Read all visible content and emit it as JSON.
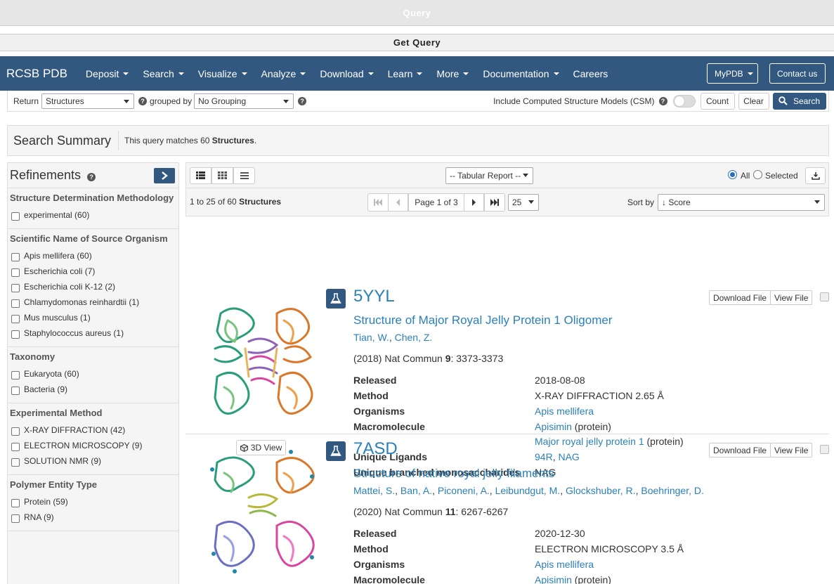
{
  "query_bar": {
    "title": "Query"
  },
  "get_query_bar": {
    "title": "Get Query"
  },
  "nav": {
    "brand": "RCSB PDB",
    "items": [
      "Deposit",
      "Search",
      "Visualize",
      "Analyze",
      "Download",
      "Learn",
      "More",
      "Documentation"
    ],
    "careers": "Careers",
    "mypdb": "MyPDB",
    "contact": "Contact us"
  },
  "search_row": {
    "return_label": "Return",
    "return_value": "Structures",
    "grouped_label": "grouped by",
    "group_value": "No Grouping",
    "csm_label": "Include Computed Structure Models (CSM)",
    "count": "Count",
    "clear": "Clear",
    "search": "Search"
  },
  "summary": {
    "title": "Search Summary",
    "text": "This query matches 60",
    "bold": "Structures",
    "period": "."
  },
  "refinements": {
    "title": "Refinements",
    "groups": [
      {
        "title": "Structure Determination Methodology",
        "items": [
          "experimental (60)"
        ]
      },
      {
        "title": "Scientific Name of Source Organism",
        "items": [
          "Apis mellifera (60)",
          "Escherichia coli (7)",
          "Escherichia coli K-12 (2)",
          "Chlamydomonas reinhardtii (1)",
          "Mus musculus (1)",
          "Staphylococcus aureus (1)"
        ]
      },
      {
        "title": "Taxonomy",
        "items": [
          "Eukaryota (60)",
          "Bacteria (9)"
        ]
      },
      {
        "title": "Experimental Method",
        "items": [
          "X-RAY DIFFRACTION (42)",
          "ELECTRON MICROSCOPY (9)",
          "SOLUTION NMR (9)"
        ]
      },
      {
        "title": "Polymer Entity Type",
        "items": [
          "Protein (59)",
          "RNA (9)"
        ]
      }
    ]
  },
  "toolbar": {
    "report": "-- Tabular Report --",
    "all": "All",
    "selected": "Selected"
  },
  "pager": {
    "range": "1 to 25 of 60",
    "range_bold": "Structures",
    "page": "Page 1 of 3",
    "per_page": "25",
    "sort_label": "Sort by",
    "sort_value": "↓ Score"
  },
  "entries": [
    {
      "id": "5YYL",
      "title": "Structure of Major Royal Jelly Protein 1 Oligomer",
      "authors": [
        "Tian, W.",
        "Chen, Z."
      ],
      "cite_pre": "(2018) Nat Commun",
      "cite_vol": "9",
      "cite_pages": ": 3373-3373",
      "released": "2018-08-08",
      "method": "X-RAY DIFFRACTION 2.65 Å",
      "organism": "Apis mellifera",
      "macro1": "Apisimin",
      "macro1_type": "(protein)",
      "macro2": "Major royal jelly protein 1",
      "macro2_type": "(protein)",
      "ligand1": "94R",
      "ligand2": "NAG",
      "mono": "NAG"
    },
    {
      "id": "7ASD",
      "title": "Structure of native royal jelly filaments",
      "authors": [
        "Mattei, S.",
        "Ban, A.",
        "Piconeni, A.",
        "Leibundgut, M.",
        "Glockshuber, R.",
        "Boehringer, D."
      ],
      "cite_pre": "(2020) Nat Commun",
      "cite_vol": "11",
      "cite_pages": ": 6267-6267",
      "released": "2020-12-30",
      "method": "ELECTRON MICROSCOPY 3.5 Å",
      "organism": "Apis mellifera",
      "macro1": "Apisimin",
      "macro1_type": "(protein)"
    }
  ],
  "labels": {
    "released": "Released",
    "method": "Method",
    "organisms": "Organisms",
    "macromolecule": "Macromolecule",
    "ligands": "Unique Ligands",
    "mono": "Unique branched monosaccharides",
    "download": "Download File",
    "view": "View File",
    "view3d": "3D View"
  },
  "colors": {
    "nav": "#325880",
    "link": "#2a80b9"
  }
}
